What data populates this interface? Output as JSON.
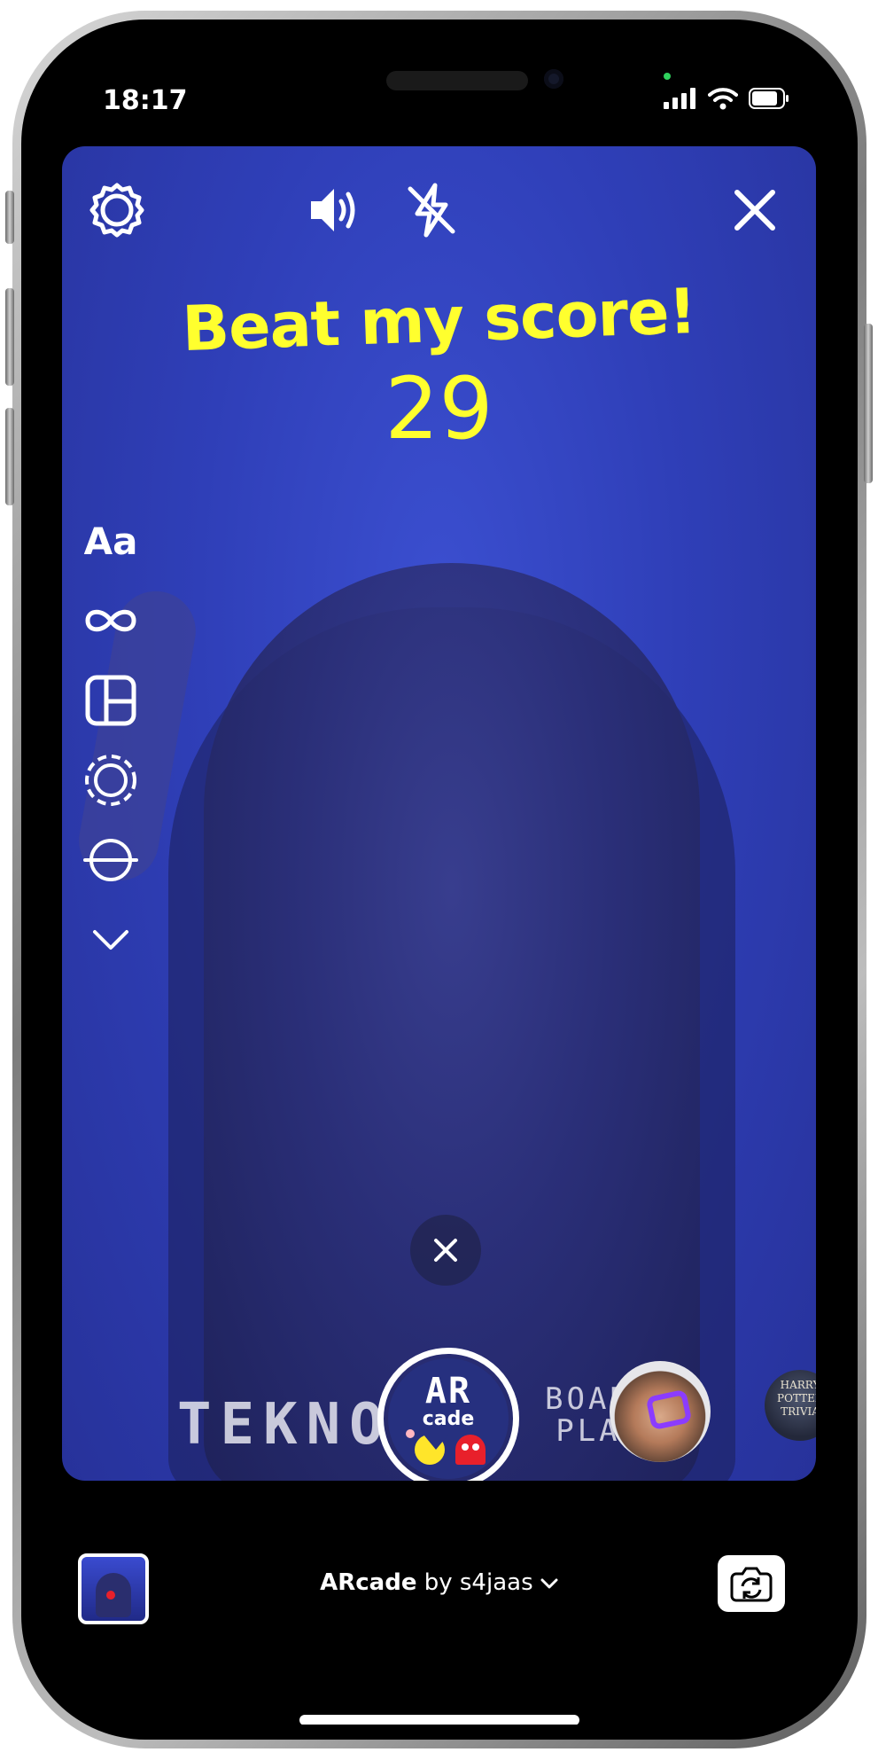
{
  "status_bar": {
    "time": "18:17"
  },
  "overlay": {
    "headline": "Beat my score!",
    "score": "29"
  },
  "tools": {
    "text_tool_label": "Aa"
  },
  "effects": {
    "tekno_text": "TEKNO",
    "board_text_line1": "BOARD",
    "board_text_line2": "PLAY",
    "arcade_logo_line1": "AR",
    "arcade_logo_line2": "cade",
    "harry_potter_line1": "HARRY",
    "harry_potter_line2": "POTTER",
    "harry_potter_line3": "TRIVIA"
  },
  "bottom": {
    "effect_name": "ARcade",
    "by_label": "by s4jaas"
  },
  "colors": {
    "overlay_text": "#ffff2e",
    "camera_bg": "#2f3fb8"
  },
  "icons": [
    "gear-icon",
    "speaker-icon",
    "flash-off-icon",
    "close-icon",
    "infinity-icon",
    "layout-icon",
    "dashed-circle-icon",
    "level-icon",
    "chevron-down-icon",
    "flip-camera-icon"
  ]
}
